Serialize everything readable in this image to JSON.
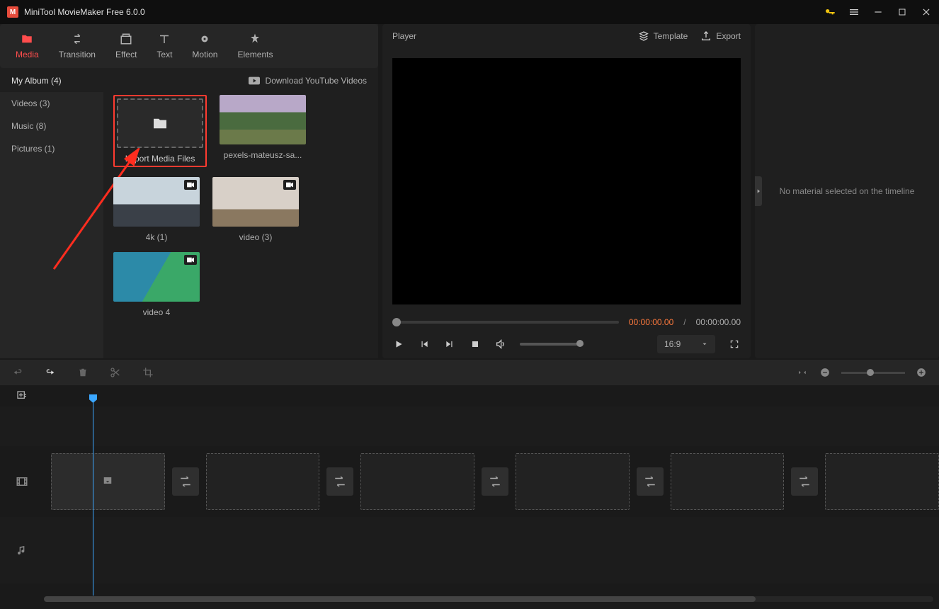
{
  "titlebar": {
    "title": "MiniTool MovieMaker Free 6.0.0"
  },
  "tabs": {
    "media": "Media",
    "transition": "Transition",
    "effect": "Effect",
    "text": "Text",
    "motion": "Motion",
    "elements": "Elements"
  },
  "sidebar": {
    "myalbum": "My Album (4)",
    "videos": "Videos (3)",
    "music": "Music (8)",
    "pictures": "Pictures (1)"
  },
  "media": {
    "download_yt": "Download YouTube Videos",
    "import_label": "Import Media Files",
    "items": [
      {
        "label": "pexels-mateusz-sa..."
      },
      {
        "label": "4k (1)"
      },
      {
        "label": "video (3)"
      },
      {
        "label": "video 4"
      }
    ]
  },
  "player": {
    "title": "Player",
    "template": "Template",
    "export": "Export",
    "time_current": "00:00:00.00",
    "time_sep": "/",
    "time_total": "00:00:00.00",
    "aspect": "16:9"
  },
  "right_panel": {
    "empty": "No material selected on the timeline"
  }
}
